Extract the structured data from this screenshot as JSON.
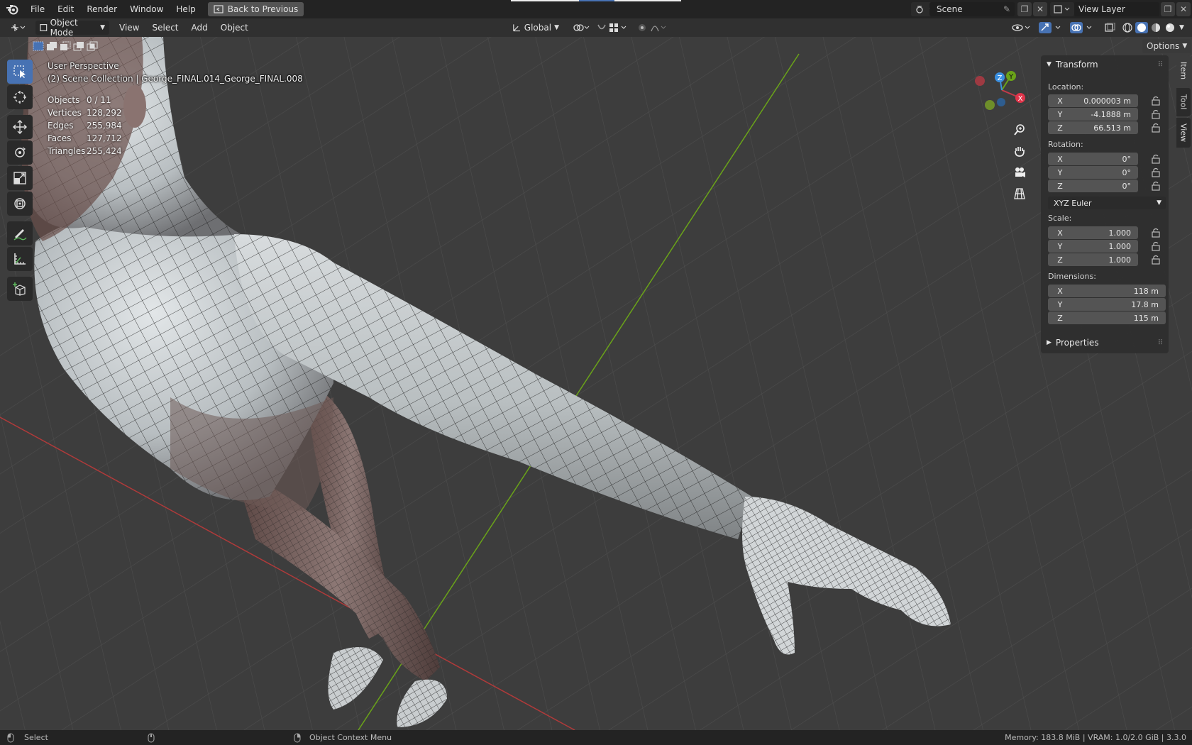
{
  "menubar": {
    "items": [
      "File",
      "Edit",
      "Render",
      "Window",
      "Help"
    ],
    "back_button": "Back to Previous",
    "scene_label": "Scene",
    "view_layer_label": "View Layer"
  },
  "header": {
    "mode": "Object Mode",
    "menus": [
      "View",
      "Select",
      "Add",
      "Object"
    ],
    "orientation": "Global",
    "options_label": "Options"
  },
  "viewport": {
    "perspective": "User Perspective",
    "collection": "(2) Scene Collection | George_FINAL.014_George_FINAL.008",
    "stats": [
      {
        "label": "Objects",
        "value": "0 / 11"
      },
      {
        "label": "Vertices",
        "value": "128,292"
      },
      {
        "label": "Edges",
        "value": "255,984"
      },
      {
        "label": "Faces",
        "value": "127,712"
      },
      {
        "label": "Triangles",
        "value": "255,424"
      }
    ]
  },
  "gizmo": {
    "x": "X",
    "y": "Y",
    "z": "Z"
  },
  "npanel": {
    "transform_title": "Transform",
    "location_label": "Location:",
    "location": [
      {
        "axis": "X",
        "value": "0.000003 m"
      },
      {
        "axis": "Y",
        "value": "-4.1888 m"
      },
      {
        "axis": "Z",
        "value": "66.513 m"
      }
    ],
    "rotation_label": "Rotation:",
    "rotation": [
      {
        "axis": "X",
        "value": "0°"
      },
      {
        "axis": "Y",
        "value": "0°"
      },
      {
        "axis": "Z",
        "value": "0°"
      }
    ],
    "rotation_mode": "XYZ Euler",
    "scale_label": "Scale:",
    "scale": [
      {
        "axis": "X",
        "value": "1.000"
      },
      {
        "axis": "Y",
        "value": "1.000"
      },
      {
        "axis": "Z",
        "value": "1.000"
      }
    ],
    "dimensions_label": "Dimensions:",
    "dimensions": [
      {
        "axis": "X",
        "value": "118 m"
      },
      {
        "axis": "Y",
        "value": "17.8 m"
      },
      {
        "axis": "Z",
        "value": "115 m"
      }
    ],
    "properties_title": "Properties",
    "tabs": [
      "Item",
      "Tool",
      "View"
    ]
  },
  "statusbar": {
    "left": "Select",
    "middle": "Object Context Menu",
    "right": "Memory: 183.8 MiB | VRAM: 1.0/2.0 GiB | 3.3.0"
  },
  "colors": {
    "accent": "#4772b3",
    "x_axis": "#e0344a",
    "y_axis": "#6aa319",
    "z_axis": "#3a8fe0"
  }
}
